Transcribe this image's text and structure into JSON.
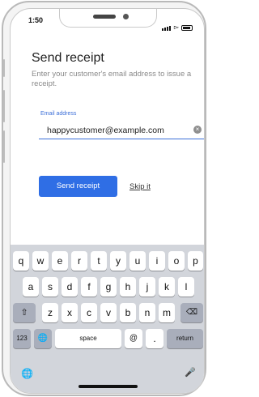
{
  "status": {
    "time": "1:50"
  },
  "page": {
    "title": "Send receipt",
    "subtitle": "Enter your customer's email address to issue a receipt."
  },
  "email": {
    "label": "Email address",
    "value": "happycustomer@example.com"
  },
  "actions": {
    "send_label": "Send receipt",
    "skip_label": "Skip it"
  },
  "keyboard": {
    "row1": [
      "q",
      "w",
      "e",
      "r",
      "t",
      "y",
      "u",
      "i",
      "o",
      "p"
    ],
    "row2": [
      "a",
      "s",
      "d",
      "f",
      "g",
      "h",
      "j",
      "k",
      "l"
    ],
    "row3": [
      "z",
      "x",
      "c",
      "v",
      "b",
      "n",
      "m"
    ],
    "numbers_label": "123",
    "space_label": "space",
    "at_label": "@",
    "dot_label": ".",
    "return_label": "return"
  },
  "colors": {
    "accent": "#2f6ee5",
    "field_accent": "#3c6fd8"
  }
}
